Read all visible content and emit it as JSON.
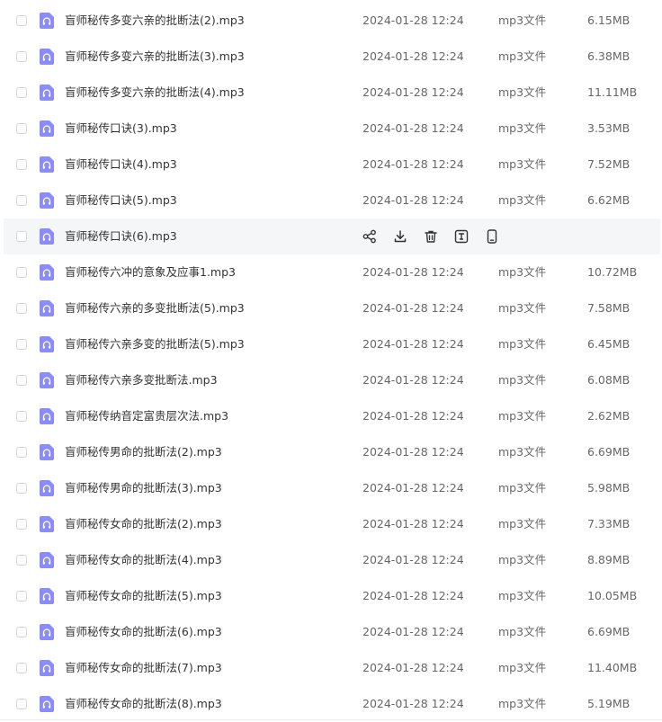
{
  "colors": {
    "icon_bg": "#8b8cf7",
    "hover_bg": "#f5f6f8",
    "text_primary": "#333333",
    "text_secondary": "#666666"
  },
  "files": [
    {
      "name": "盲师秘传多变六亲的批断法(2).mp3",
      "date": "2024-01-28 12:24",
      "type": "mp3文件",
      "size": "6.15MB"
    },
    {
      "name": "盲师秘传多变六亲的批断法(3).mp3",
      "date": "2024-01-28 12:24",
      "type": "mp3文件",
      "size": "6.38MB"
    },
    {
      "name": "盲师秘传多变六亲的批断法(4).mp3",
      "date": "2024-01-28 12:24",
      "type": "mp3文件",
      "size": "11.11MB"
    },
    {
      "name": "盲师秘传口诀(3).mp3",
      "date": "2024-01-28 12:24",
      "type": "mp3文件",
      "size": "3.53MB"
    },
    {
      "name": "盲师秘传口诀(4).mp3",
      "date": "2024-01-28 12:24",
      "type": "mp3文件",
      "size": "7.52MB"
    },
    {
      "name": "盲师秘传口诀(5).mp3",
      "date": "2024-01-28 12:24",
      "type": "mp3文件",
      "size": "6.62MB"
    },
    {
      "name": "盲师秘传口诀(6).mp3",
      "hovered": true
    },
    {
      "name": "盲师秘传六冲的意象及应事1.mp3",
      "date": "2024-01-28 12:24",
      "type": "mp3文件",
      "size": "10.72MB"
    },
    {
      "name": "盲师秘传六亲的多变批断法(5).mp3",
      "date": "2024-01-28 12:24",
      "type": "mp3文件",
      "size": "7.58MB"
    },
    {
      "name": "盲师秘传六亲多变的批断法(5).mp3",
      "date": "2024-01-28 12:24",
      "type": "mp3文件",
      "size": "6.45MB"
    },
    {
      "name": "盲师秘传六亲多变批断法.mp3",
      "date": "2024-01-28 12:24",
      "type": "mp3文件",
      "size": "6.08MB"
    },
    {
      "name": "盲师秘传纳音定富贵层次法.mp3",
      "date": "2024-01-28 12:24",
      "type": "mp3文件",
      "size": "2.62MB"
    },
    {
      "name": "盲师秘传男命的批断法(2).mp3",
      "date": "2024-01-28 12:24",
      "type": "mp3文件",
      "size": "6.69MB"
    },
    {
      "name": "盲师秘传男命的批断法(3).mp3",
      "date": "2024-01-28 12:24",
      "type": "mp3文件",
      "size": "5.98MB"
    },
    {
      "name": "盲师秘传女命的批断法(2).mp3",
      "date": "2024-01-28 12:24",
      "type": "mp3文件",
      "size": "7.33MB"
    },
    {
      "name": "盲师秘传女命的批断法(4).mp3",
      "date": "2024-01-28 12:24",
      "type": "mp3文件",
      "size": "8.89MB"
    },
    {
      "name": "盲师秘传女命的批断法(5).mp3",
      "date": "2024-01-28 12:24",
      "type": "mp3文件",
      "size": "10.05MB"
    },
    {
      "name": "盲师秘传女命的批断法(6).mp3",
      "date": "2024-01-28 12:24",
      "type": "mp3文件",
      "size": "6.69MB"
    },
    {
      "name": "盲师秘传女命的批断法(7).mp3",
      "date": "2024-01-28 12:24",
      "type": "mp3文件",
      "size": "11.40MB"
    },
    {
      "name": "盲师秘传女命的批断法(8).mp3",
      "date": "2024-01-28 12:24",
      "type": "mp3文件",
      "size": "5.19MB"
    }
  ],
  "hover_actions": [
    "share-icon",
    "download-icon",
    "delete-icon",
    "rename-icon",
    "mobile-icon"
  ]
}
